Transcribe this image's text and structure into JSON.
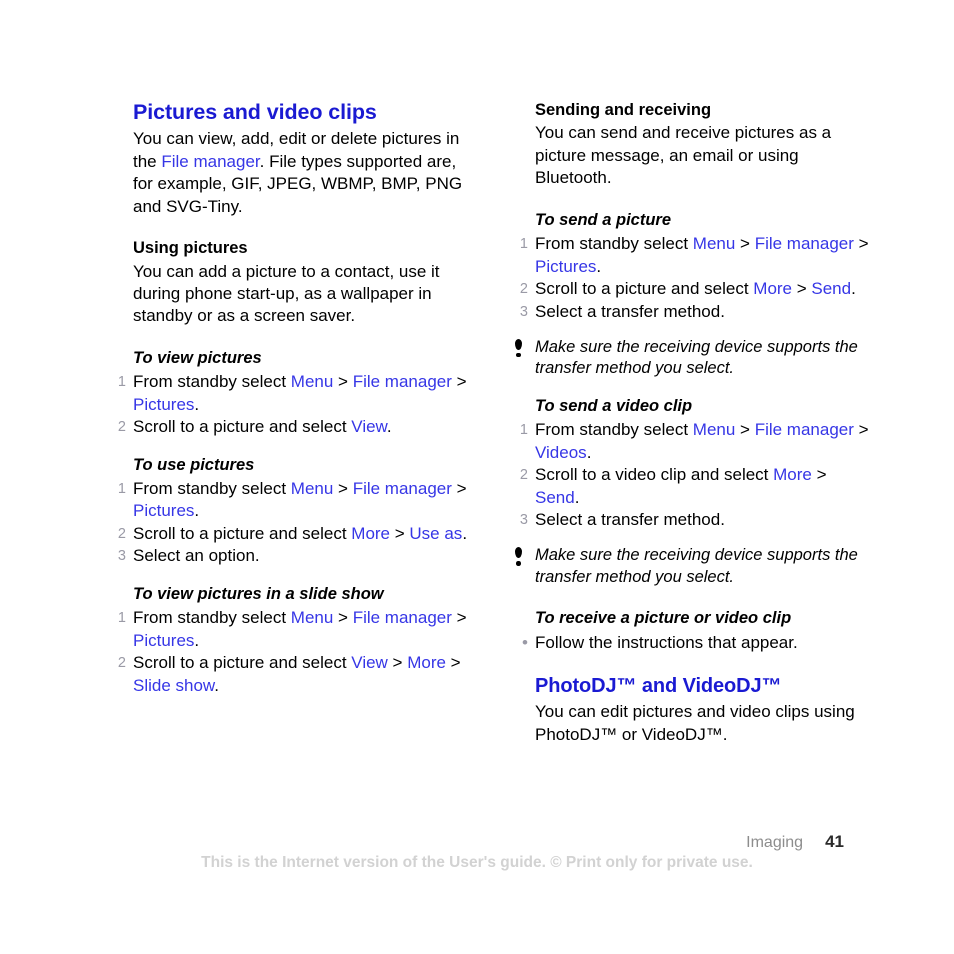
{
  "document": {
    "footer": {
      "chapter": "Imaging",
      "page_number": "41",
      "watermark": "This is the Internet version of the User's guide. © Print only for private use."
    }
  },
  "colors": {
    "heading_blue": "#1a1ad2",
    "link_blue": "#3636e6",
    "marker_gray": "#9a9aa6",
    "watermark_gray": "#d2d2d2"
  },
  "left_column": {
    "chapter_title": "Pictures and video clips",
    "intro": {
      "p1": "You can view, add, edit or delete pictures in the ",
      "link1": "File manager",
      "p2": ". File types supported are, for example, GIF, JPEG, WBMP, BMP, PNG and SVG-Tiny."
    },
    "using_pictures": {
      "heading": "Using pictures",
      "body": "You can add a picture to a contact, use it during phone start-up, as a wallpaper in standby or as a screen saver."
    },
    "to_view_pictures": {
      "heading": "To view pictures",
      "step1": {
        "text_before": "From standby select ",
        "link1": "Menu",
        "sep1": " > ",
        "link2": "File manager",
        "sep2": " > ",
        "link3": "Pictures",
        "text_after": "."
      },
      "step2": {
        "text_before": "Scroll to a picture and select ",
        "link1": "View",
        "text_after": "."
      }
    },
    "to_use_pictures": {
      "heading": "To use pictures",
      "step1": {
        "text_before": "From standby select ",
        "link1": "Menu",
        "sep1": " > ",
        "link2": "File manager",
        "sep2": " > ",
        "link3": "Pictures",
        "text_after": "."
      },
      "step2": {
        "text_before": "Scroll to a picture and select ",
        "link1": "More",
        "sep1": " > ",
        "link2": "Use as",
        "text_after": "."
      },
      "step3": "Select an option."
    },
    "to_view_slide_show": {
      "heading": "To view pictures in a slide show",
      "step1": {
        "text_before": "From standby select ",
        "link1": "Menu",
        "sep1": " > ",
        "link2": "File manager",
        "sep2": " > ",
        "link3": "Pictures",
        "text_after": "."
      },
      "step2": {
        "text_before": "Scroll to a picture and select ",
        "link1": "View",
        "sep1": " > ",
        "link2": "More",
        "sep2": " > ",
        "link3": "Slide show",
        "text_after": "."
      }
    }
  },
  "right_column": {
    "sending_and_receiving": {
      "heading": "Sending and receiving",
      "body": "You can send and receive pictures as a picture message, an email or using Bluetooth."
    },
    "to_send_a_picture": {
      "heading": "To send a picture",
      "step1": {
        "text_before": "From standby select ",
        "link1": "Menu",
        "sep1": " > ",
        "link2": "File manager",
        "sep2": " > ",
        "link3": "Pictures",
        "text_after": "."
      },
      "step2": {
        "text_before": "Scroll to a picture and select ",
        "link1": "More",
        "sep1": " > ",
        "link2": "Send",
        "text_after": "."
      },
      "step3": "Select a transfer method."
    },
    "note_picture": "Make sure the receiving device supports the transfer method you select.",
    "to_send_a_video_clip": {
      "heading": "To send a video clip",
      "step1": {
        "text_before": "From standby select ",
        "link1": "Menu",
        "sep1": " > ",
        "link2": "File manager",
        "sep2": " > ",
        "link3": "Videos",
        "text_after": "."
      },
      "step2": {
        "text_before": "Scroll to a video clip and select ",
        "link1": "More",
        "sep1": " > ",
        "link2": "Send",
        "text_after": "."
      },
      "step3": "Select a transfer method."
    },
    "note_video": "Make sure the receiving device supports the transfer method you select.",
    "to_receive": {
      "heading": "To receive a picture or video clip",
      "bullet": "Follow the instructions that appear."
    },
    "photodj": {
      "heading": "PhotoDJ™ and VideoDJ™",
      "body": "You can edit pictures and video clips using PhotoDJ™ or VideoDJ™."
    }
  },
  "markers": {
    "one": "1",
    "two": "2",
    "three": "3",
    "bullet": "•"
  }
}
